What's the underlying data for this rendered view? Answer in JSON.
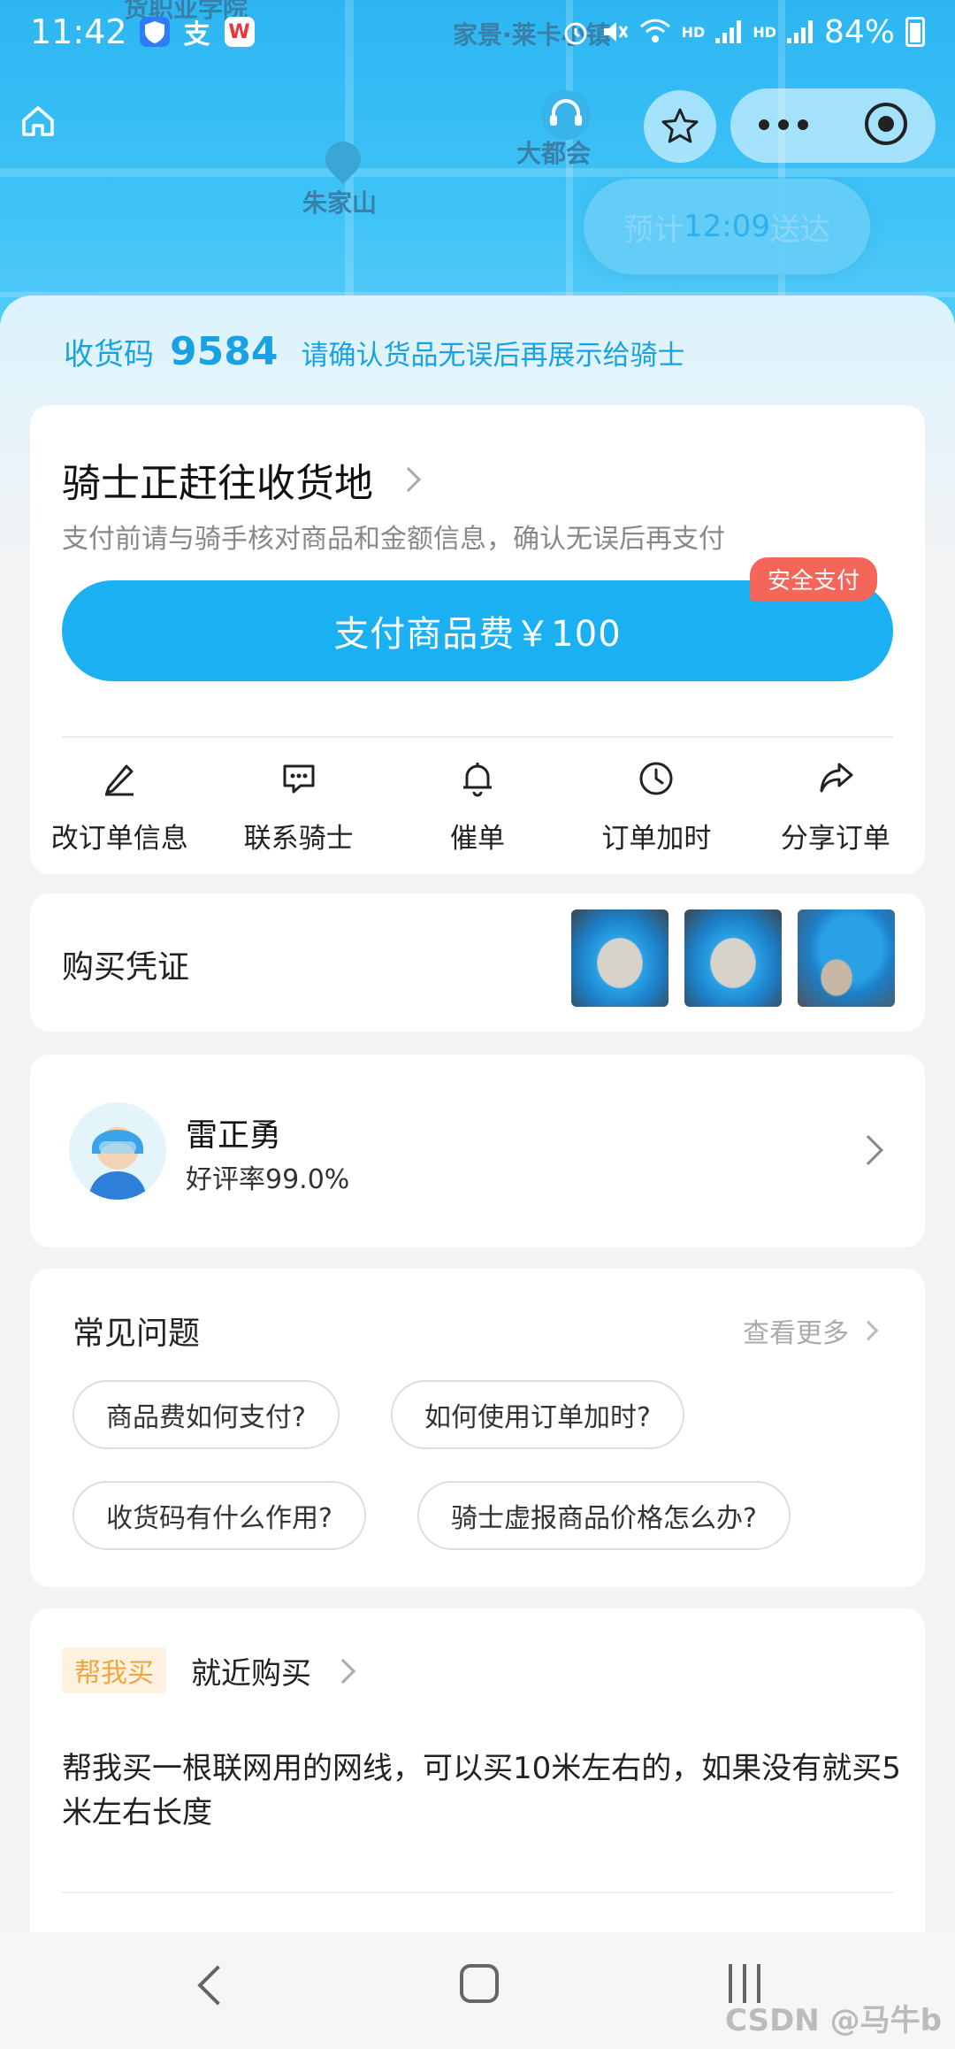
{
  "status_bar": {
    "time": "11:42",
    "icons": [
      "shield-icon",
      "alipay-icon",
      "wps-icon"
    ],
    "right_icons": [
      "alarm-icon",
      "mute-icon",
      "wifi-icon",
      "hd-signal-icon",
      "hd-signal-icon"
    ],
    "hd_label": "HD",
    "battery": "84%"
  },
  "map": {
    "labels": [
      "家景·莱卡小镇",
      "大都会",
      "朱家山",
      "货职业学院"
    ],
    "eta": {
      "prefix": "预计",
      "time": "12:09",
      "suffix": "送达"
    }
  },
  "receipt": {
    "label": "收货码",
    "code": "9584",
    "hint": "请确认货品无误后再展示给骑士"
  },
  "order_card": {
    "title": "骑士正赶往收货地",
    "subtitle": "支付前请与骑手核对商品和金额信息，确认无误后再支付",
    "pay_button": "支付商品费￥100",
    "safe_badge": "安全支付",
    "actions": [
      {
        "label": "改订单信息",
        "icon": "edit-icon"
      },
      {
        "label": "联系骑士",
        "icon": "chat-icon"
      },
      {
        "label": "催单",
        "icon": "bell-icon"
      },
      {
        "label": "订单加时",
        "icon": "clock-icon"
      },
      {
        "label": "分享订单",
        "icon": "share-icon"
      }
    ]
  },
  "proof_card": {
    "label": "购买凭证",
    "images": [
      "network-cable-photo-1",
      "network-cable-photo-2",
      "network-cable-photo-3"
    ]
  },
  "rider": {
    "name": "雷正勇",
    "rating": "好评率99.0%"
  },
  "faq": {
    "title": "常见问题",
    "more": "查看更多",
    "questions": [
      "商品费如何支付?",
      "如何使用订单加时?",
      "收货码有什么作用?",
      "骑士虚报商品价格怎么办?"
    ]
  },
  "order_detail": {
    "tag": "帮我买",
    "type": "就近购买",
    "note": "帮我买一根联网用的网线，可以买10米左右的，如果没有就买5米左右长度"
  },
  "watermark": "CSDN @马牛b",
  "colors": {
    "brand": "#1bb0f2",
    "map": "#2db6f2",
    "badge": "#f4655a",
    "tag_bg": "#fff1e0",
    "tag_text": "#f0a640"
  }
}
